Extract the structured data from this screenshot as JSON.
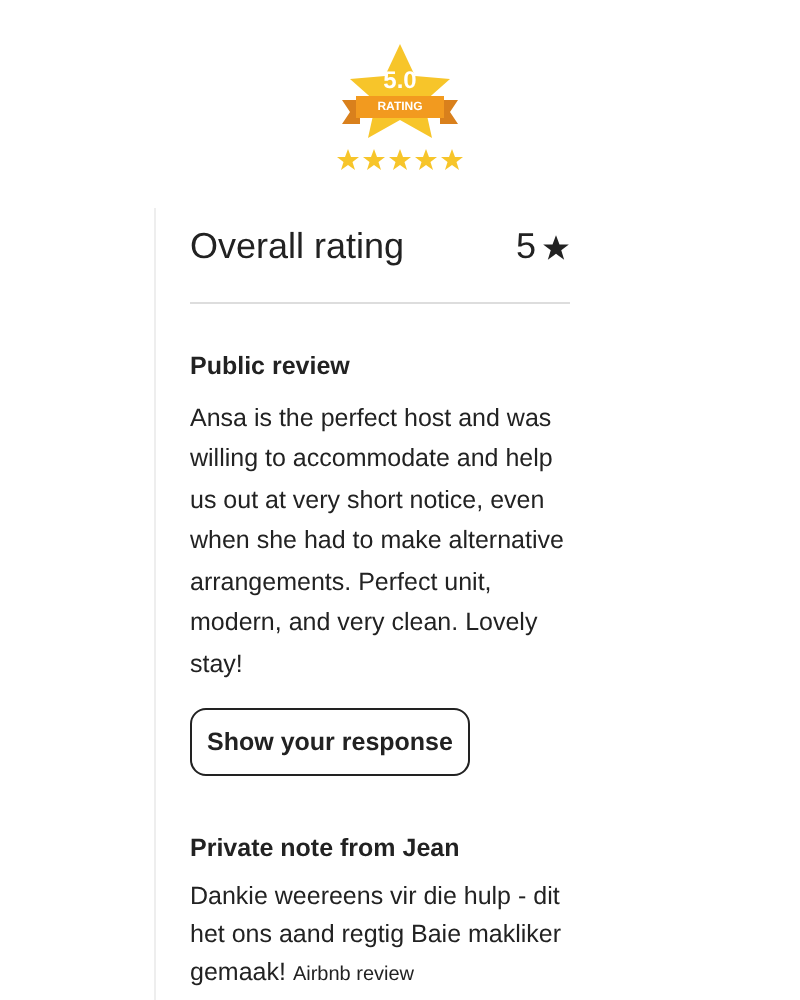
{
  "badge": {
    "score": "5.0",
    "label": "RATING",
    "stars": 5
  },
  "card": {
    "title": "Overall rating",
    "rating": "5",
    "public_review": {
      "heading": "Public review",
      "text": "Ansa is the perfect host and was willing to accommodate and help us out at very short notice, even when she had to make alternative arrangements. Perfect unit, modern, and very clean. Lovely stay!"
    },
    "button": "Show your response",
    "private_note": {
      "heading": "Private note from Jean",
      "text": "Dankie weereens vir die hulp - dit het ons aand regtig Baie makliker gemaak!",
      "source": "Airbnb review"
    }
  }
}
